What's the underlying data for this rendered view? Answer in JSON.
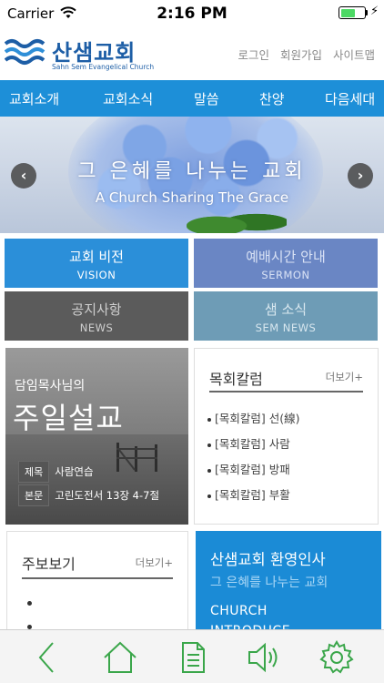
{
  "status_bar": {
    "carrier": "Carrier",
    "time": "2:16 PM",
    "battery_level": 0.62
  },
  "header": {
    "logo_name": "산샘교회",
    "logo_sub": "Sahn Sem Evangelical Church",
    "links": [
      "로그인",
      "회원가입",
      "사이트맵"
    ]
  },
  "nav": {
    "items": [
      "교회소개",
      "교회소식",
      "말씀",
      "찬양",
      "다음세대"
    ]
  },
  "banner": {
    "title": "그 은혜를 나누는 교회",
    "subtitle": "A Church Sharing The Grace",
    "prev_icon": "chevron-left-icon",
    "next_icon": "chevron-right-icon"
  },
  "quick_menu": [
    {
      "ko": "교회 비전",
      "en": "VISION"
    },
    {
      "ko": "예배시간 안내",
      "en": "SERMON"
    },
    {
      "ko": "공지사항",
      "en": "NEWS"
    },
    {
      "ko": "샘 소식",
      "en": "SEM NEWS"
    }
  ],
  "sermon": {
    "label": "담임목사님의",
    "title": "주일설교",
    "topic_tag": "제목",
    "topic": "사람연습",
    "text_tag": "본문",
    "text": "고린도전서 13장 4-7절"
  },
  "column": {
    "title": "목회칼럼",
    "more": "더보기+",
    "items": [
      "[목회칼럼] 선(線)",
      "[목회칼럼] 사람",
      "[목회칼럼] 방패",
      "[목회칼럼] 부활"
    ]
  },
  "bulletin": {
    "title": "주보보기",
    "more": "더보기+"
  },
  "welcome": {
    "title": "산샘교회 환영인사",
    "tagline": "그 은혜를 나누는 교회",
    "line1": "CHURCH",
    "line2": "INTRODUCE"
  },
  "toolbar": {
    "icons": [
      "back-icon",
      "home-icon",
      "document-icon",
      "speaker-icon",
      "settings-icon"
    ]
  },
  "colors": {
    "primary_blue": "#1d8fd8",
    "icon_green": "#3aa64a"
  }
}
